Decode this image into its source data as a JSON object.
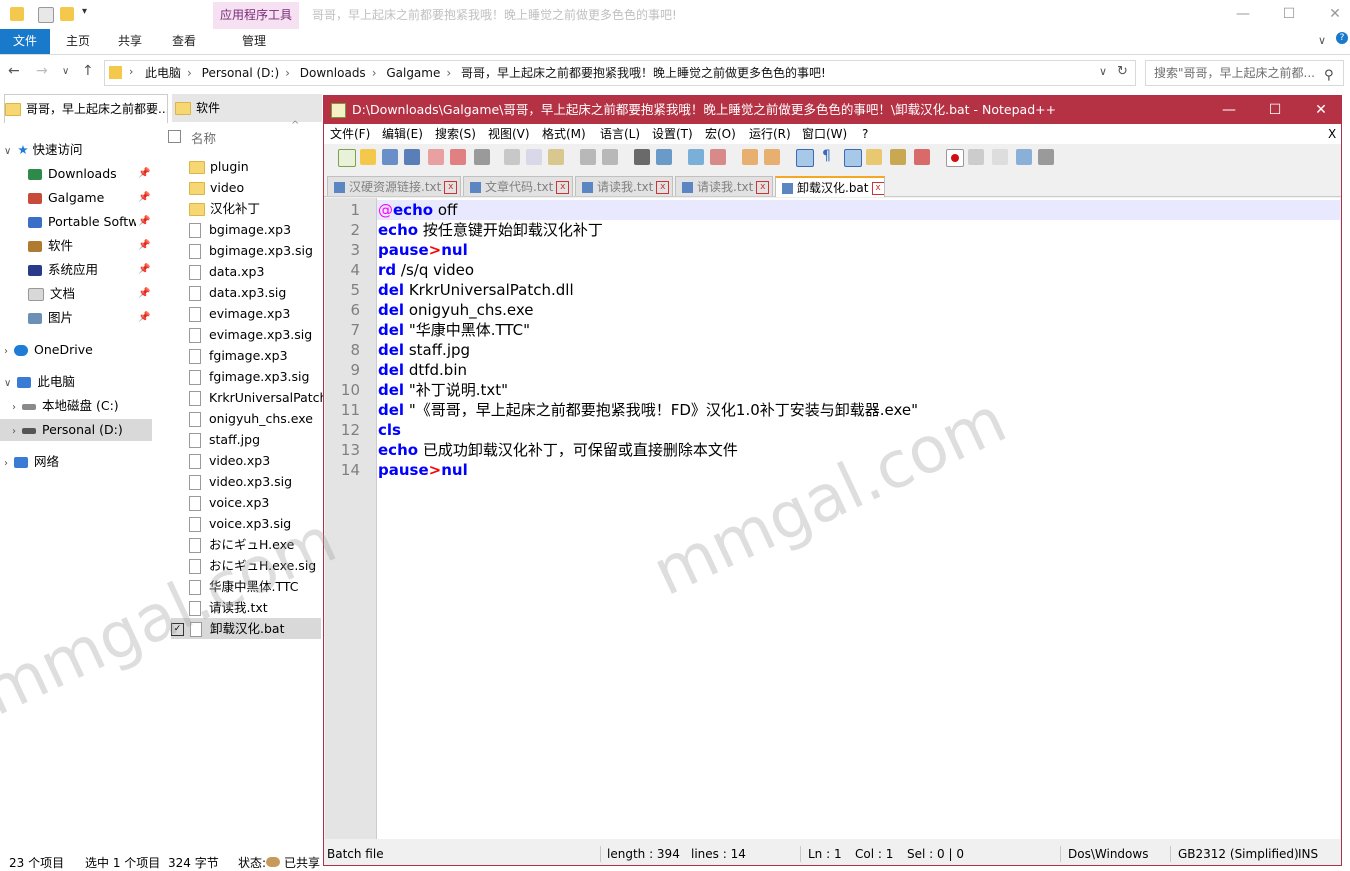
{
  "explorer": {
    "window_title": "哥哥，早上起床之前都要抱紧我哦！晚上睡觉之前做更多色色的事吧!",
    "context_tab": "应用程序工具",
    "ribbon_tabs": [
      "文件",
      "主页",
      "共享",
      "查看",
      "管理"
    ],
    "breadcrumbs": [
      "此电脑",
      "Personal (D:)",
      "Downloads",
      "Galgame",
      "哥哥，早上起床之前都要抱紧我哦！晚上睡觉之前做更多色色的事吧!"
    ],
    "search_placeholder": "搜索\"哥哥，早上起床之前都...",
    "tabs": [
      "哥哥，早上起床之前都要...",
      "软件"
    ],
    "nav": {
      "quick_access": "快速访问",
      "items": [
        "Downloads",
        "Galgame",
        "Portable Softwa",
        "软件",
        "系统应用",
        "文档",
        "图片"
      ],
      "onedrive": "OneDrive",
      "this_pc": "此电脑",
      "drives": [
        "本地磁盘 (C:)",
        "Personal (D:)"
      ],
      "network": "网络"
    },
    "column_header": "名称",
    "files": [
      "plugin",
      "video",
      "汉化补丁",
      "bgimage.xp3",
      "bgimage.xp3.sig",
      "data.xp3",
      "data.xp3.sig",
      "evimage.xp3",
      "evimage.xp3.sig",
      "fgimage.xp3",
      "fgimage.xp3.sig",
      "KrkrUniversalPatch.",
      "onigyuh_chs.exe",
      "staff.jpg",
      "video.xp3",
      "video.xp3.sig",
      "voice.xp3",
      "voice.xp3.sig",
      "おにギュH.exe",
      "おにギュH.exe.sig",
      "华康中黑体.TTC",
      "请读我.txt",
      "卸载汉化.bat"
    ],
    "status": {
      "count": "23 个项目",
      "selected": "选中 1 个项目",
      "size": "324 字节",
      "state_label": "状态:",
      "state_value": "已共享"
    }
  },
  "notepad": {
    "title": "D:\\Downloads\\Galgame\\哥哥，早上起床之前都要抱紧我哦！晚上睡觉之前做更多色色的事吧！\\卸载汉化.bat - Notepad++",
    "menu": [
      "文件(F)",
      "编辑(E)",
      "搜索(S)",
      "视图(V)",
      "格式(M)",
      "语言(L)",
      "设置(T)",
      "宏(O)",
      "运行(R)",
      "窗口(W)",
      "?"
    ],
    "close_x": "X",
    "tabs": [
      "汉硬资源链接.txt",
      "文章代码.txt",
      "请读我.txt",
      "请读我.txt",
      "卸载汉化.bat"
    ],
    "lines": [
      {
        "n": "1"
      },
      {
        "n": "2"
      },
      {
        "n": "3"
      },
      {
        "n": "4"
      },
      {
        "n": "5"
      },
      {
        "n": "6"
      },
      {
        "n": "7"
      },
      {
        "n": "8"
      },
      {
        "n": "9"
      },
      {
        "n": "10"
      },
      {
        "n": "11"
      },
      {
        "n": "12"
      },
      {
        "n": "13"
      },
      {
        "n": "14"
      }
    ],
    "code": {
      "l1_at": "@",
      "l1_kw": "echo",
      "l1_rest": " off",
      "l2_kw": "echo",
      "l2_rest": " 按任意键开始卸载汉化补丁",
      "l3_kw": "pause",
      "l3_op": ">",
      "l3_kw2": "nul",
      "l4_kw": "rd",
      "l4_rest": " /s/q video",
      "l5_kw": "del",
      "l5_rest": " KrkrUniversalPatch.dll",
      "l6_kw": "del",
      "l6_rest": " onigyuh_chs.exe",
      "l7_kw": "del",
      "l7_rest": " \"华康中黑体.TTC\"",
      "l8_kw": "del",
      "l8_rest": " staff.jpg",
      "l9_kw": "del",
      "l9_rest": " dtfd.bin",
      "l10_kw": "del",
      "l10_rest": " \"补丁说明.txt\"",
      "l11_kw": "del",
      "l11_rest": " \"《哥哥，早上起床之前都要抱紧我哦！FD》汉化1.0补丁安装与卸载器.exe\"",
      "l12_kw": "cls",
      "l13_kw": "echo",
      "l13_rest": " 已成功卸载汉化补丁，可保留或直接删除本文件",
      "l14_kw": "pause",
      "l14_op": ">",
      "l14_kw2": "nul"
    },
    "status": {
      "lang": "Batch file",
      "length": "length : 394",
      "lines": "lines : 14",
      "ln": "Ln : 1",
      "col": "Col : 1",
      "sel": "Sel : 0 | 0",
      "eol": "Dos\\Windows",
      "encoding": "GB2312 (Simplified)",
      "mode": "INS"
    }
  },
  "watermark": "mmgal.com",
  "colors": {
    "npp_title": "#b53245",
    "keyword": "#0000ff",
    "accent_blue": "#1979ca"
  }
}
